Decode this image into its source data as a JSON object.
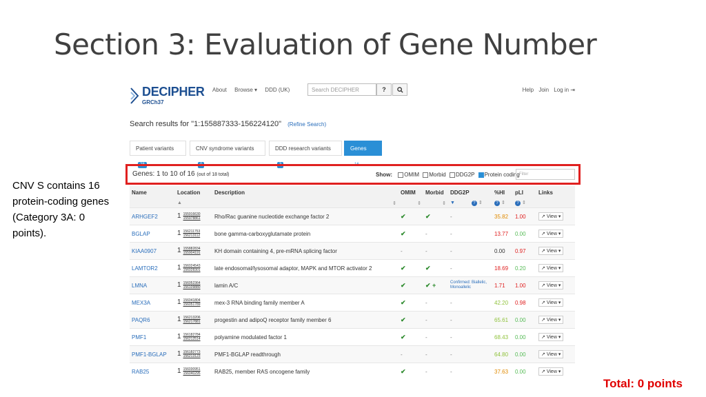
{
  "slide": {
    "title": "Section 3: Evaluation of Gene Number",
    "note": "CNV S contains 16 protein-coding genes (Category 3A: 0 points).",
    "total": "Total: 0 points"
  },
  "decipher": {
    "logo_name": "DECIPHER",
    "logo_sub": "GRCh37",
    "nav": [
      "About",
      "Browse ▾",
      "DDD (UK)"
    ],
    "search_placeholder": "Search DECIPHER",
    "right_nav": [
      "Help",
      "Join",
      "Log in ⇥"
    ],
    "results_prefix": "Search results for",
    "results_query": "\"1:155887333-156224120\"",
    "refine": "(Refine Search)",
    "tabs": [
      {
        "label": "Patient variants",
        "badge": "28"
      },
      {
        "label": "CNV syndrome variants",
        "badge": "0"
      },
      {
        "label": "DDD research variants",
        "badge": "3"
      },
      {
        "label": "Genes",
        "badge": "16"
      }
    ],
    "genes_count": "Genes: 1 to 10 of 16",
    "genes_count_small": "(out of 18 total)",
    "show_label": "Show:",
    "show_options": [
      "OMIM",
      "Morbid",
      "DDG2P",
      "Protein coding"
    ],
    "filter_placeholder": "Filter",
    "columns": [
      "Name",
      "Location",
      "Description",
      "OMIM",
      "Morbid",
      "DDG2P",
      "%HI",
      "pLI",
      "Links"
    ],
    "view_label": "View ▾",
    "rows": [
      {
        "name": "ARHGEF2",
        "chr": "1",
        "start": "155916630",
        "end": "155978861",
        "desc": "Rho/Rac guanine nucleotide exchange factor 2",
        "omim": "✔",
        "morbid": "✔",
        "ddg2p": "-",
        "hi": "35.82",
        "hi_color": "#e08a00",
        "pli": "1.00",
        "pli_color": "#e02020"
      },
      {
        "name": "BGLAP",
        "chr": "1",
        "start": "156211753",
        "end": "156213112",
        "desc": "bone gamma-carboxyglutamate protein",
        "omim": "✔",
        "morbid": "-",
        "ddg2p": "-",
        "hi": "13.77",
        "hi_color": "#e02020",
        "pli": "0.00",
        "pli_color": "#55bb55"
      },
      {
        "name": "KIAA0907",
        "chr": "1",
        "start": "155882834",
        "end": "155904191",
        "desc": "KH domain containing 4, pre-mRNA splicing factor",
        "omim": "-",
        "morbid": "-",
        "ddg2p": "-",
        "hi": "0.00",
        "hi_color": "#333333",
        "pli": "0.97",
        "pli_color": "#e02020"
      },
      {
        "name": "LAMTOR2",
        "chr": "1",
        "start": "156024543",
        "end": "156028301",
        "desc": "late endosomal/lysosomal adaptor, MAPK and MTOR activator 2",
        "omim": "✔",
        "morbid": "✔",
        "ddg2p": "-",
        "hi": "18.69",
        "hi_color": "#e02020",
        "pli": "0.20",
        "pli_color": "#55bb55"
      },
      {
        "name": "LMNA",
        "chr": "1",
        "start": "156052364",
        "end": "156109880",
        "desc": "lamin A/C",
        "omim": "✔",
        "morbid": "✔ +",
        "ddg2p": "Confirmed: Biallelic, Monoallelic",
        "hi": "1.71",
        "hi_color": "#e02020",
        "pli": "1.00",
        "pli_color": "#e02020"
      },
      {
        "name": "MEX3A",
        "chr": "1",
        "start": "156041804",
        "end": "156051789",
        "desc": "mex-3 RNA binding family member A",
        "omim": "✔",
        "morbid": "-",
        "ddg2p": "-",
        "hi": "42.20",
        "hi_color": "#8fc23b",
        "pli": "0.98",
        "pli_color": "#e02020"
      },
      {
        "name": "PAQR6",
        "chr": "1",
        "start": "156213206",
        "end": "156217881",
        "desc": "progestin and adipoQ receptor family member 6",
        "omim": "✔",
        "morbid": "-",
        "ddg2p": "-",
        "hi": "65.61",
        "hi_color": "#8fc23b",
        "pli": "0.00",
        "pli_color": "#55bb55"
      },
      {
        "name": "PMF1",
        "chr": "1",
        "start": "156182784",
        "end": "156212514",
        "desc": "polyamine modulated factor 1",
        "omim": "✔",
        "morbid": "-",
        "ddg2p": "-",
        "hi": "68.43",
        "hi_color": "#8fc23b",
        "pli": "0.00",
        "pli_color": "#55bb55"
      },
      {
        "name": "PMF1-BGLAP",
        "chr": "1",
        "start": "156182773",
        "end": "156213123",
        "desc": "PMF1-BGLAP readthrough",
        "omim": "-",
        "morbid": "-",
        "ddg2p": "-",
        "hi": "64.80",
        "hi_color": "#8fc23b",
        "pli": "0.00",
        "pli_color": "#55bb55"
      },
      {
        "name": "RAB25",
        "chr": "1",
        "start": "156030951",
        "end": "156040295",
        "desc": "RAB25, member RAS oncogene family",
        "omim": "✔",
        "morbid": "-",
        "ddg2p": "-",
        "hi": "37.63",
        "hi_color": "#e08a00",
        "pli": "0.00",
        "pli_color": "#55bb55"
      }
    ]
  }
}
